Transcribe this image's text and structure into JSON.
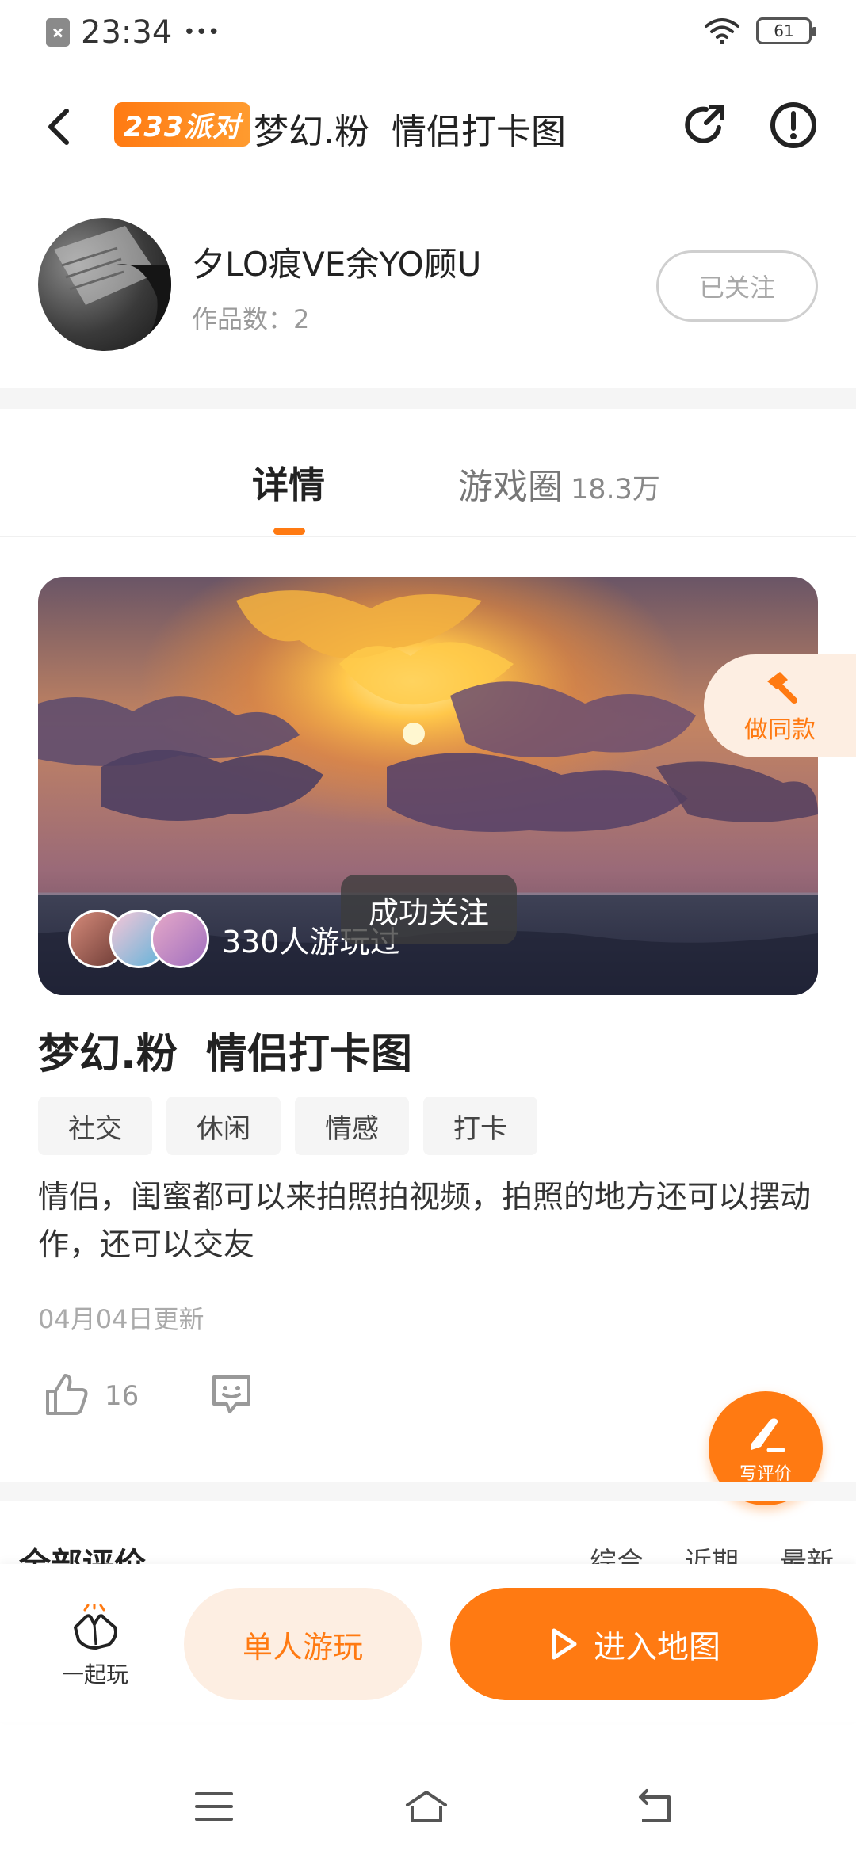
{
  "status_bar": {
    "time": "23:34",
    "dots": "•••",
    "battery": "61"
  },
  "header": {
    "brand": "233派对",
    "title": "梦幻.粉  情侣打卡图",
    "back_icon": "back-arrow-icon",
    "share_icon": "share-icon",
    "report_icon": "exclamation-icon"
  },
  "author": {
    "name": "夕LO痕VE余YO顾U",
    "works_label": "作品数：2",
    "follow_label": "已关注"
  },
  "tabs": [
    {
      "label": "详情",
      "active": true
    },
    {
      "label": "游戏圈",
      "count": "18.3万",
      "active": false
    }
  ],
  "banner": {
    "player_count_label": "330人游玩过",
    "toast": "成功关注",
    "make_same_label": "做同款"
  },
  "game": {
    "title": "梦幻.粉  情侣打卡图",
    "tags": [
      "社交",
      "休闲",
      "情感",
      "打卡"
    ],
    "description": "情侣，闺蜜都可以来拍照拍视频，拍照的地方还可以摆动作，还可以交友",
    "updated": "04月04日更新",
    "likes": "16"
  },
  "write_review_label": "写评价",
  "reviews": {
    "title": "全部评价",
    "sort_options": [
      "综合",
      "近期",
      "最新"
    ]
  },
  "bottom_bar": {
    "together_label": "一起玩",
    "single_play_label": "单人游玩",
    "enter_map_label": "进入地图"
  },
  "colors": {
    "accent": "#ff7a12",
    "accent_light": "#fdeee2"
  }
}
